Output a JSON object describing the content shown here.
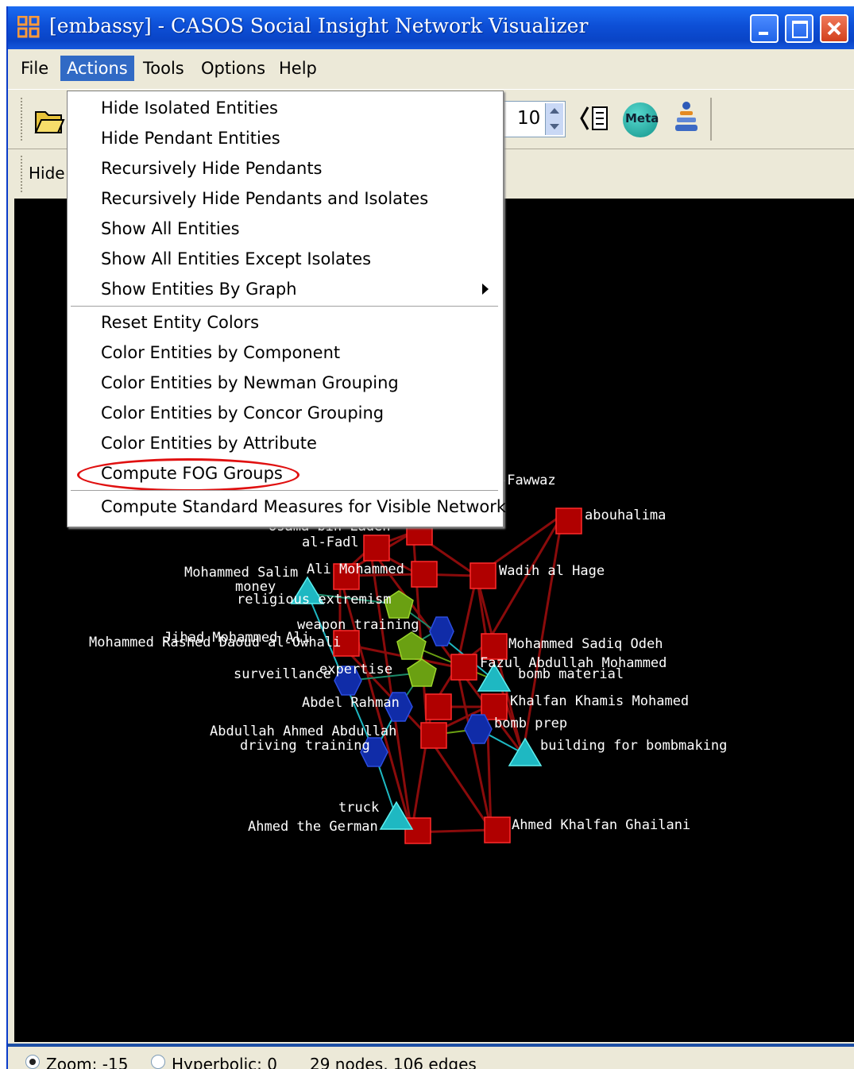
{
  "window": {
    "title": "[embassy] - CASOS Social Insight Network Visualizer"
  },
  "menubar": {
    "items": [
      "File",
      "Actions",
      "Tools",
      "Options",
      "Help"
    ],
    "active": "Actions"
  },
  "toolbar": {
    "spinner_value": "10",
    "meta_label": "Meta",
    "hide_label": "Hide",
    "icons": [
      "folder-open-icon",
      "spinner-arrows-icon",
      "tree-list-icon",
      "meta-node-icon",
      "person-stack-icon"
    ]
  },
  "actions_menu": {
    "items": [
      "Hide Isolated Entities",
      "Hide Pendant Entities",
      "Recursively Hide Pendants",
      "Recursively Hide Pendants and Isolates",
      "Show All Entities",
      "Show All Entities Except Isolates",
      "Show Entities By Graph",
      "Reset Entity Colors",
      "Color Entities by Component",
      "Color Entities by Newman Grouping",
      "Color Entities by Concor Grouping",
      "Color Entities by Attribute",
      "Compute FOG Groups",
      "Compute Standard Measures for Visible Network"
    ],
    "highlighted": "Compute FOG Groups"
  },
  "network": {
    "labels": [
      "-Fawwaz",
      "abouhalima",
      "Usama bin Laden",
      "al-Fadl",
      "Mohammed Salim",
      "Ali Mohammed",
      "money",
      "religious extremism",
      "Wadih al Hage",
      "weapon training",
      "Mohammed Rashed Daoud al-Owhali",
      "Jihad Mohammed Ali",
      "expertise",
      "Mohammed Sadiq Odeh",
      "Fazul Abdullah Mohammed",
      "surveillance",
      "bomb material",
      "Abdel Rahman",
      "Khalfan Khamis Mohamed",
      "bomb prep",
      "Abdullah Ahmed Abdullah",
      "driving training",
      "building for bombmaking",
      "truck",
      "Ahmed the German",
      "Ahmed Khalfan Ghailani"
    ],
    "colors": {
      "agent": "#b00000",
      "resource": "#1eb8c2",
      "knowledge": "#102ca8",
      "task": "#6aa012",
      "edge": "#8a0b0b"
    }
  },
  "status": {
    "zoom_label": "Zoom: -15",
    "hyperbolic_label": "Hyperbolic: 0",
    "counts": "29 nodes, 106 edges"
  }
}
